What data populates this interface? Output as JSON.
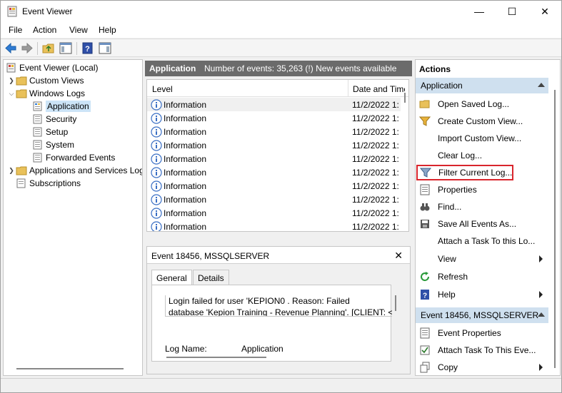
{
  "window": {
    "title": "Event Viewer",
    "controls": {
      "minimize": "—",
      "maximize": "☐",
      "close": "✕"
    }
  },
  "menu": [
    "File",
    "Action",
    "View",
    "Help"
  ],
  "toolbar": {
    "icons": [
      "back-arrow-icon",
      "forward-arrow-icon",
      "folder-up-icon",
      "show-hide-tree-icon",
      "help-icon",
      "show-hide-actions-icon"
    ]
  },
  "tree": {
    "root": "Event Viewer (Local)",
    "custom_views": "Custom Views",
    "windows_logs": "Windows Logs",
    "logs": [
      "Application",
      "Security",
      "Setup",
      "System",
      "Forwarded Events"
    ],
    "apps_services": "Applications and Services Logs",
    "subscriptions": "Subscriptions"
  },
  "log_header": {
    "name": "Application",
    "summary": "Number of events: 35,263 (!) New events available"
  },
  "events": {
    "columns": [
      "Level",
      "Date and Time"
    ],
    "rows": [
      {
        "level": "Information",
        "date": "11/2/2022 1:"
      },
      {
        "level": "Information",
        "date": "11/2/2022 1:"
      },
      {
        "level": "Information",
        "date": "11/2/2022 1:"
      },
      {
        "level": "Information",
        "date": "11/2/2022 1:"
      },
      {
        "level": "Information",
        "date": "11/2/2022 1:"
      },
      {
        "level": "Information",
        "date": "11/2/2022 1:"
      },
      {
        "level": "Information",
        "date": "11/2/2022 1:"
      },
      {
        "level": "Information",
        "date": "11/2/2022 1:"
      },
      {
        "level": "Information",
        "date": "11/2/2022 1:"
      },
      {
        "level": "Information",
        "date": "11/2/2022 1:"
      }
    ]
  },
  "detail": {
    "title": "Event 18456, MSSQLSERVER",
    "close": "✕",
    "tabs": [
      "General",
      "Details"
    ],
    "message_line1": "Login failed for user 'KEPION0                    . Reason: Failed",
    "message_line2": "database 'Kepion Training - Revenue Planning'. [CLIENT: <lo",
    "log_name_label": "Log Name:",
    "log_name_value": "Application"
  },
  "actions": {
    "title": "Actions",
    "section1": "Application",
    "items1": [
      {
        "label": "Open Saved Log...",
        "icon": "open-folder-icon",
        "submenu": false
      },
      {
        "label": "Create Custom View...",
        "icon": "funnel-icon",
        "submenu": false
      },
      {
        "label": "Import Custom View...",
        "icon": "",
        "submenu": false
      },
      {
        "label": "Clear Log...",
        "icon": "",
        "submenu": false
      },
      {
        "label": "Filter Current Log...",
        "icon": "filter-icon",
        "submenu": false
      },
      {
        "label": "Properties",
        "icon": "properties-icon",
        "submenu": false
      },
      {
        "label": "Find...",
        "icon": "binoculars-icon",
        "submenu": false
      },
      {
        "label": "Save All Events As...",
        "icon": "save-icon",
        "submenu": false
      },
      {
        "label": "Attach a Task To this Lo...",
        "icon": "",
        "submenu": false
      },
      {
        "label": "View",
        "icon": "",
        "submenu": true
      },
      {
        "label": "Refresh",
        "icon": "refresh-icon",
        "submenu": false
      },
      {
        "label": "Help",
        "icon": "help-icon",
        "submenu": true
      }
    ],
    "section2": "Event 18456, MSSQLSERVER",
    "items2": [
      {
        "label": "Event Properties",
        "icon": "properties-icon",
        "submenu": false
      },
      {
        "label": "Attach Task To This Eve...",
        "icon": "task-icon",
        "submenu": false
      },
      {
        "label": "Copy",
        "icon": "copy-icon",
        "submenu": true
      }
    ]
  },
  "colors": {
    "highlight_box": "#d9252c",
    "section_header": "#cfe0ef",
    "log_header_bg": "#6b6b6b",
    "selected_tree": "#cce4f7"
  }
}
